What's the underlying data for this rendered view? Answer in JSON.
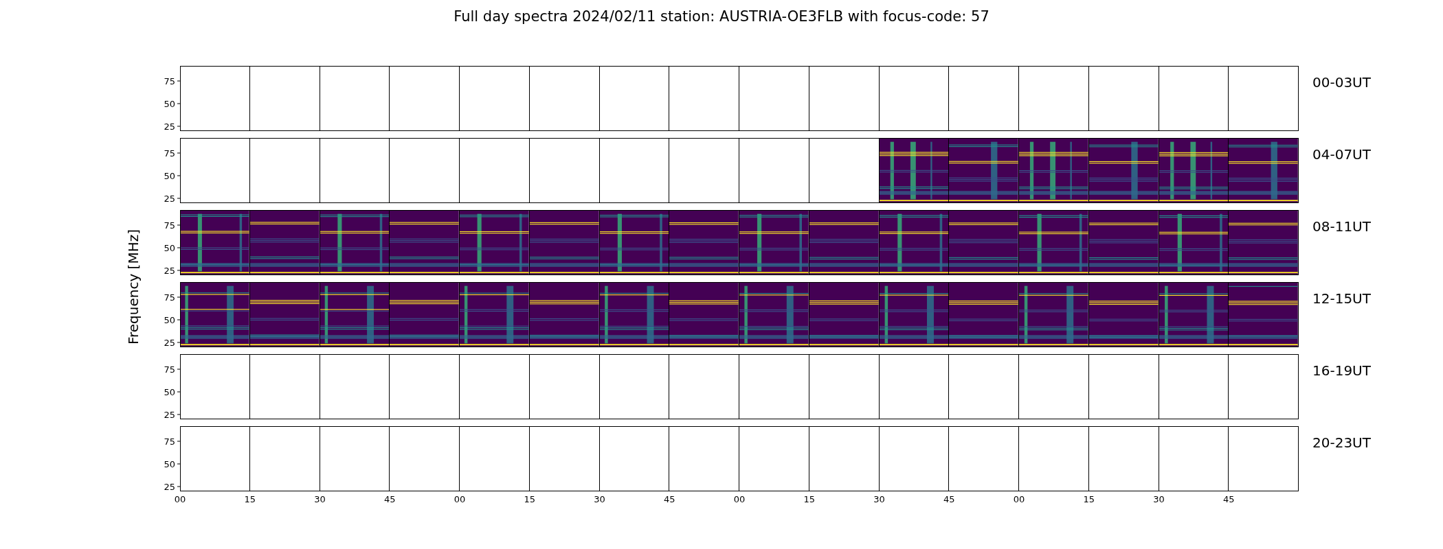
{
  "title": "Full day spectra 2024/02/11 station: AUSTRIA-OE3FLB with focus-code: 57",
  "ylabel": "Frequency [MHz]",
  "xticks": [
    "00",
    "15",
    "30",
    "45",
    "00",
    "15",
    "30",
    "45",
    "00",
    "15",
    "30",
    "45",
    "00",
    "15",
    "30",
    "45"
  ],
  "rows": [
    {
      "label": "00-03UT",
      "yticks": [
        "75",
        "50",
        "25"
      ],
      "panels": [
        {
          "has_data": false
        },
        {
          "has_data": false
        },
        {
          "has_data": false
        },
        {
          "has_data": false
        },
        {
          "has_data": false
        },
        {
          "has_data": false
        },
        {
          "has_data": false
        },
        {
          "has_data": false
        },
        {
          "has_data": false
        },
        {
          "has_data": false
        },
        {
          "has_data": false
        },
        {
          "has_data": false
        },
        {
          "has_data": false
        },
        {
          "has_data": false
        },
        {
          "has_data": false
        },
        {
          "has_data": false
        }
      ]
    },
    {
      "label": "04-07UT",
      "yticks": [
        "75",
        "50",
        "25"
      ],
      "panels": [
        {
          "has_data": false
        },
        {
          "has_data": false
        },
        {
          "has_data": false
        },
        {
          "has_data": false
        },
        {
          "has_data": false
        },
        {
          "has_data": false
        },
        {
          "has_data": false
        },
        {
          "has_data": false
        },
        {
          "has_data": false
        },
        {
          "has_data": false
        },
        {
          "has_data": true
        },
        {
          "has_data": true
        },
        {
          "has_data": true
        },
        {
          "has_data": true
        },
        {
          "has_data": true
        },
        {
          "has_data": true
        }
      ]
    },
    {
      "label": "08-11UT",
      "yticks": [
        "75",
        "50",
        "25"
      ],
      "panels": [
        {
          "has_data": true
        },
        {
          "has_data": true
        },
        {
          "has_data": true
        },
        {
          "has_data": true
        },
        {
          "has_data": true
        },
        {
          "has_data": true
        },
        {
          "has_data": true
        },
        {
          "has_data": true
        },
        {
          "has_data": true
        },
        {
          "has_data": true
        },
        {
          "has_data": true
        },
        {
          "has_data": true
        },
        {
          "has_data": true
        },
        {
          "has_data": true
        },
        {
          "has_data": true
        },
        {
          "has_data": true
        }
      ]
    },
    {
      "label": "12-15UT",
      "yticks": [
        "75",
        "50",
        "25"
      ],
      "panels": [
        {
          "has_data": true
        },
        {
          "has_data": true
        },
        {
          "has_data": true
        },
        {
          "has_data": true
        },
        {
          "has_data": true
        },
        {
          "has_data": true
        },
        {
          "has_data": true
        },
        {
          "has_data": true
        },
        {
          "has_data": true
        },
        {
          "has_data": true
        },
        {
          "has_data": true
        },
        {
          "has_data": true
        },
        {
          "has_data": true
        },
        {
          "has_data": true
        },
        {
          "has_data": true
        },
        {
          "has_data": true
        }
      ]
    },
    {
      "label": "16-19UT",
      "yticks": [
        "75",
        "50",
        "25"
      ],
      "panels": [
        {
          "has_data": false
        },
        {
          "has_data": false
        },
        {
          "has_data": false
        },
        {
          "has_data": false
        },
        {
          "has_data": false
        },
        {
          "has_data": false
        },
        {
          "has_data": false
        },
        {
          "has_data": false
        },
        {
          "has_data": false
        },
        {
          "has_data": false
        },
        {
          "has_data": false
        },
        {
          "has_data": false
        },
        {
          "has_data": false
        },
        {
          "has_data": false
        },
        {
          "has_data": false
        },
        {
          "has_data": false
        }
      ]
    },
    {
      "label": "20-23UT",
      "yticks": [
        "75",
        "50",
        "25"
      ],
      "panels": [
        {
          "has_data": false
        },
        {
          "has_data": false
        },
        {
          "has_data": false
        },
        {
          "has_data": false
        },
        {
          "has_data": false
        },
        {
          "has_data": false
        },
        {
          "has_data": false
        },
        {
          "has_data": false
        },
        {
          "has_data": false
        },
        {
          "has_data": false
        },
        {
          "has_data": false
        },
        {
          "has_data": false
        },
        {
          "has_data": false
        },
        {
          "has_data": false
        },
        {
          "has_data": false
        },
        {
          "has_data": false
        }
      ]
    }
  ]
}
